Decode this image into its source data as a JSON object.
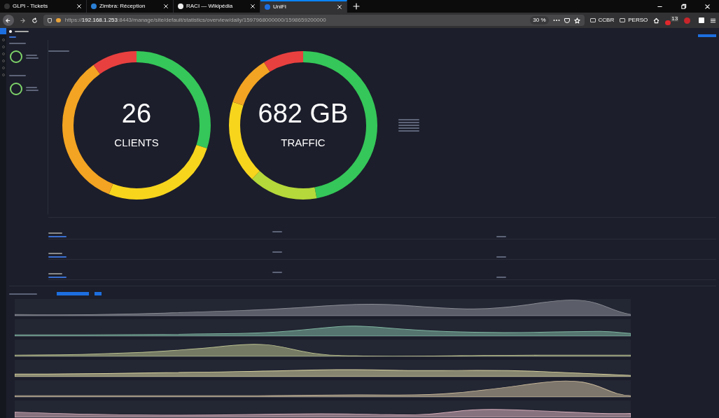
{
  "browser": {
    "tabs": [
      {
        "title": "GLPI - Tickets",
        "selected": false
      },
      {
        "title": "Zimbra: Réception",
        "selected": false
      },
      {
        "title": "RACI — Wikipédia",
        "selected": false
      },
      {
        "title": "UniFi",
        "selected": true
      }
    ],
    "url_prefix": "https://",
    "url_host": "192.168.1.253",
    "url_rest": ":8443/manage/site/default/statistics/overview/daily/1597968000000/1598659200000",
    "zoom": "30 %",
    "bookmarks": [
      "CCBR",
      "PERSO"
    ],
    "notification_count": "13"
  },
  "stats": [
    {
      "value": "26",
      "label": "CLIENTS",
      "kind": "clients"
    },
    {
      "value": "682 GB",
      "label": "TRAFFIC",
      "kind": "traffic"
    }
  ]
}
